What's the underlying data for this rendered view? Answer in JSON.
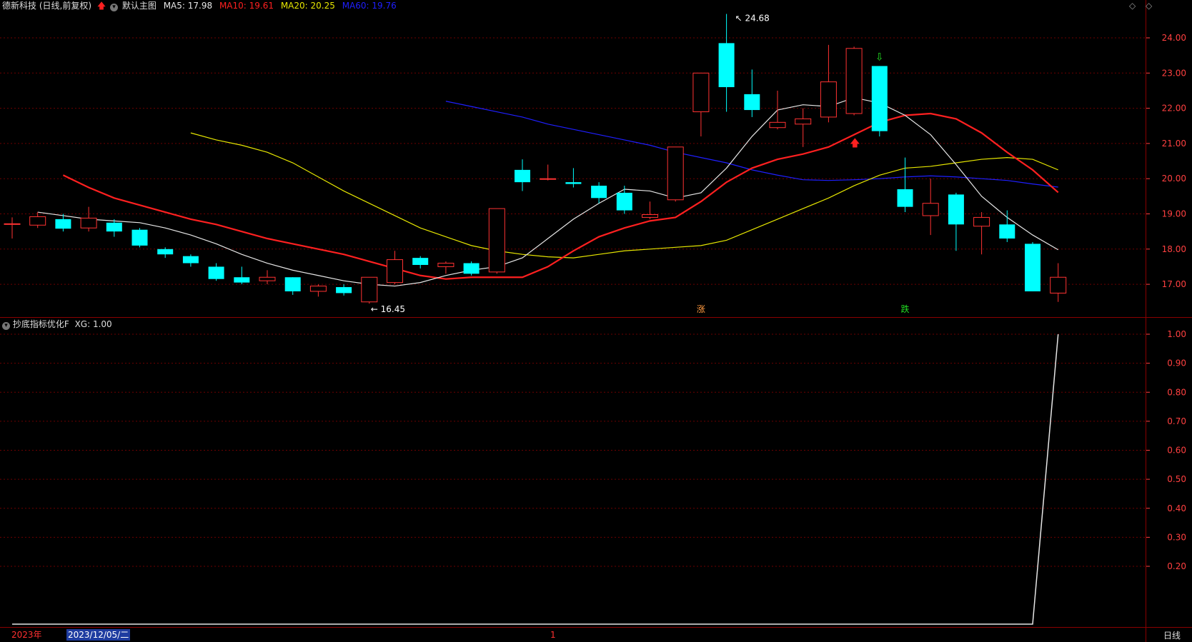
{
  "main_panel": {
    "stock_name": "德新科技",
    "period_adjust": "(日线,前复权)",
    "template_label": "默认主图",
    "indicators": [
      {
        "label": "MA5: 17.98",
        "color": "#e6e6e6"
      },
      {
        "label": "MA10: 19.61",
        "color": "#ff2020"
      },
      {
        "label": "MA20: 20.25",
        "color": "#e6e600"
      },
      {
        "label": "MA60: 19.76",
        "color": "#1f1fff"
      }
    ],
    "high_marker": "24.68",
    "low_marker": "16.45",
    "signal_rise": "涨",
    "signal_fall": "跌"
  },
  "sub_panel": {
    "title": "抄底指标优化F",
    "value_label": "XG: 1.00"
  },
  "axis": {
    "price_ticks": [
      "24.00",
      "23.00",
      "22.00",
      "21.00",
      "20.00",
      "19.00",
      "18.00",
      "17.00"
    ],
    "sub_ticks": [
      "1.00",
      "0.90",
      "0.80",
      "0.70",
      "0.60",
      "0.50",
      "0.40",
      "0.30",
      "0.20"
    ]
  },
  "bottom_bar": {
    "year_label": "2023年",
    "date_label": "2023/12/05/二",
    "mid_marker": "1",
    "period_button": "日线"
  },
  "colors": {
    "up": "#ff3232",
    "down": "#00ffff",
    "ma5": "#e6e6e6",
    "ma10": "#ff2020",
    "ma20": "#e6e600",
    "ma60": "#1f1fff",
    "axis": "#ff4040",
    "grid": "#6e0000"
  },
  "chart_data": {
    "type": "candlestick",
    "series": [
      {
        "name": "K",
        "ohlc": [
          [
            18.7,
            18.72,
            18.3,
            18.9
          ],
          [
            18.68,
            18.92,
            18.6,
            19.05
          ],
          [
            18.85,
            18.58,
            18.5,
            19.0
          ],
          [
            18.6,
            18.88,
            18.5,
            19.2
          ],
          [
            18.75,
            18.5,
            18.35,
            18.85
          ],
          [
            18.55,
            18.1,
            18.05,
            18.6
          ],
          [
            18.0,
            17.85,
            17.75,
            18.05
          ],
          [
            17.8,
            17.6,
            17.5,
            17.85
          ],
          [
            17.5,
            17.15,
            17.1,
            17.6
          ],
          [
            17.2,
            17.05,
            17.0,
            17.5
          ],
          [
            17.1,
            17.2,
            17.0,
            17.4
          ],
          [
            17.2,
            16.8,
            16.7,
            17.2
          ],
          [
            16.8,
            16.95,
            16.65,
            17.0
          ],
          [
            16.92,
            16.75,
            16.68,
            17.0
          ],
          [
            16.5,
            17.2,
            16.45,
            17.2
          ],
          [
            17.05,
            17.7,
            17.0,
            17.95
          ],
          [
            17.75,
            17.55,
            17.45,
            17.8
          ],
          [
            17.5,
            17.6,
            17.3,
            17.65
          ],
          [
            17.6,
            17.3,
            17.25,
            17.65
          ],
          [
            17.35,
            19.15,
            17.3,
            19.15
          ],
          [
            20.25,
            19.9,
            19.65,
            20.55
          ],
          [
            20.0,
            20.0,
            19.95,
            20.4
          ],
          [
            19.9,
            19.85,
            19.75,
            20.3
          ],
          [
            19.8,
            19.45,
            19.3,
            19.9
          ],
          [
            19.6,
            19.1,
            19.0,
            19.8
          ],
          [
            18.9,
            18.98,
            18.85,
            19.35
          ],
          [
            19.4,
            20.9,
            19.35,
            20.9
          ],
          [
            21.9,
            23.0,
            21.2,
            23.0
          ],
          [
            23.85,
            22.6,
            21.9,
            24.68
          ],
          [
            22.4,
            21.95,
            21.75,
            23.1
          ],
          [
            21.45,
            21.6,
            21.4,
            22.5
          ],
          [
            21.55,
            21.7,
            20.9,
            22.0
          ],
          [
            21.75,
            22.75,
            21.6,
            23.8
          ],
          [
            21.85,
            23.7,
            21.8,
            23.75
          ],
          [
            23.2,
            21.35,
            21.2,
            23.2
          ],
          [
            19.7,
            19.2,
            19.05,
            20.6
          ],
          [
            18.95,
            19.3,
            18.4,
            20.0
          ],
          [
            19.55,
            18.7,
            17.95,
            19.6
          ],
          [
            18.65,
            18.9,
            17.85,
            19.05
          ],
          [
            18.7,
            18.3,
            18.2,
            19.1
          ],
          [
            18.15,
            16.8,
            16.8,
            18.2
          ],
          [
            16.75,
            17.2,
            16.5,
            17.6
          ]
        ]
      },
      {
        "name": "MA5",
        "values": [
          19.05,
          18.95,
          18.85,
          18.8,
          18.75,
          18.6,
          18.4,
          18.15,
          17.85,
          17.6,
          17.4,
          17.25,
          17.1,
          17.0,
          16.95,
          17.05,
          17.25,
          17.4,
          17.5,
          17.75,
          18.3,
          18.85,
          19.3,
          19.7,
          19.65,
          19.45,
          19.6,
          20.3,
          21.2,
          21.95,
          22.1,
          22.05,
          22.3,
          22.15,
          21.8,
          21.25,
          20.4,
          19.5,
          18.9,
          18.4,
          17.98
        ]
      },
      {
        "name": "MA10",
        "values": [
          20.1,
          19.75,
          19.45,
          19.25,
          19.05,
          18.85,
          18.7,
          18.5,
          18.3,
          18.15,
          18.0,
          17.85,
          17.65,
          17.45,
          17.25,
          17.15,
          17.2,
          17.2,
          17.2,
          17.5,
          17.95,
          18.35,
          18.6,
          18.8,
          18.9,
          19.35,
          19.9,
          20.3,
          20.55,
          20.7,
          20.9,
          21.25,
          21.6,
          21.8,
          21.85,
          21.7,
          21.3,
          20.75,
          20.25,
          19.61
        ]
      },
      {
        "name": "MA20",
        "values": [
          21.3,
          21.1,
          20.95,
          20.75,
          20.45,
          20.05,
          19.65,
          19.3,
          18.95,
          18.6,
          18.35,
          18.1,
          17.95,
          17.85,
          17.78,
          17.75,
          17.85,
          17.95,
          18.0,
          18.05,
          18.1,
          18.25,
          18.55,
          18.85,
          19.15,
          19.45,
          19.8,
          20.1,
          20.3,
          20.35,
          20.45,
          20.55,
          20.6,
          20.55,
          20.25
        ]
      },
      {
        "name": "MA60",
        "values": [
          22.2,
          22.05,
          21.9,
          21.75,
          21.55,
          21.4,
          21.25,
          21.1,
          20.95,
          20.75,
          20.6,
          20.45,
          20.25,
          20.1,
          19.97,
          19.95,
          19.97,
          20.0,
          20.05,
          20.08,
          20.05,
          20.0,
          19.95,
          19.85,
          19.76
        ]
      },
      {
        "name": "XG",
        "values": [
          0,
          0,
          0,
          0,
          0,
          0,
          0,
          0,
          0,
          0,
          0,
          0,
          0,
          0,
          0,
          0,
          0,
          0,
          0,
          0,
          0,
          0,
          0,
          0,
          0,
          0,
          0,
          0,
          0,
          0,
          0,
          0,
          0,
          0,
          0,
          0,
          0,
          0,
          0,
          0,
          0,
          1
        ]
      }
    ],
    "ylim": [
      16.3,
      24.6
    ],
    "sub_ylim": [
      0,
      1
    ]
  }
}
